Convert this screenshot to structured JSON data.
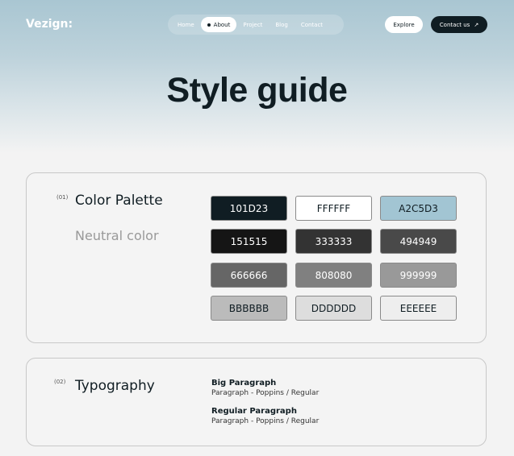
{
  "brand": {
    "logo": "Vezign:"
  },
  "nav": {
    "items": [
      {
        "label": "Home"
      },
      {
        "label": "About"
      },
      {
        "label": "Project"
      },
      {
        "label": "Blog"
      },
      {
        "label": "Contact"
      }
    ],
    "active": "About"
  },
  "actions": {
    "explore": "Explore",
    "contact": "Contact us",
    "contact_icon": "↗"
  },
  "page": {
    "title": "Style guide"
  },
  "palette": {
    "number": "(01)",
    "title": "Color Palette",
    "subtitle": "Neutral color",
    "swatches": [
      {
        "label": "101D23",
        "bg": "#101D23",
        "fg": "#ffffff"
      },
      {
        "label": "FFFFFF",
        "bg": "#FFFFFF",
        "fg": "#101D23"
      },
      {
        "label": "A2C5D3",
        "bg": "#A2C5D3",
        "fg": "#101D23"
      },
      {
        "label": "151515",
        "bg": "#151515",
        "fg": "#ffffff"
      },
      {
        "label": "333333",
        "bg": "#333333",
        "fg": "#ffffff"
      },
      {
        "label": "494949",
        "bg": "#494949",
        "fg": "#ffffff"
      },
      {
        "label": "666666",
        "bg": "#666666",
        "fg": "#ffffff"
      },
      {
        "label": "808080",
        "bg": "#808080",
        "fg": "#ffffff"
      },
      {
        "label": "999999",
        "bg": "#999999",
        "fg": "#ffffff"
      },
      {
        "label": "BBBBBB",
        "bg": "#BBBBBB",
        "fg": "#101D23"
      },
      {
        "label": "DDDDDD",
        "bg": "#DDDDDD",
        "fg": "#101D23"
      },
      {
        "label": "EEEEEE",
        "bg": "#EEEEEE",
        "fg": "#101D23"
      }
    ]
  },
  "typography": {
    "number": "(02)",
    "title": "Typography",
    "items": [
      {
        "name": "Big Paragraph",
        "desc": "Paragraph - Poppins / Regular"
      },
      {
        "name": "Regular Paragraph",
        "desc": "Paragraph - Poppins / Regular"
      }
    ]
  }
}
